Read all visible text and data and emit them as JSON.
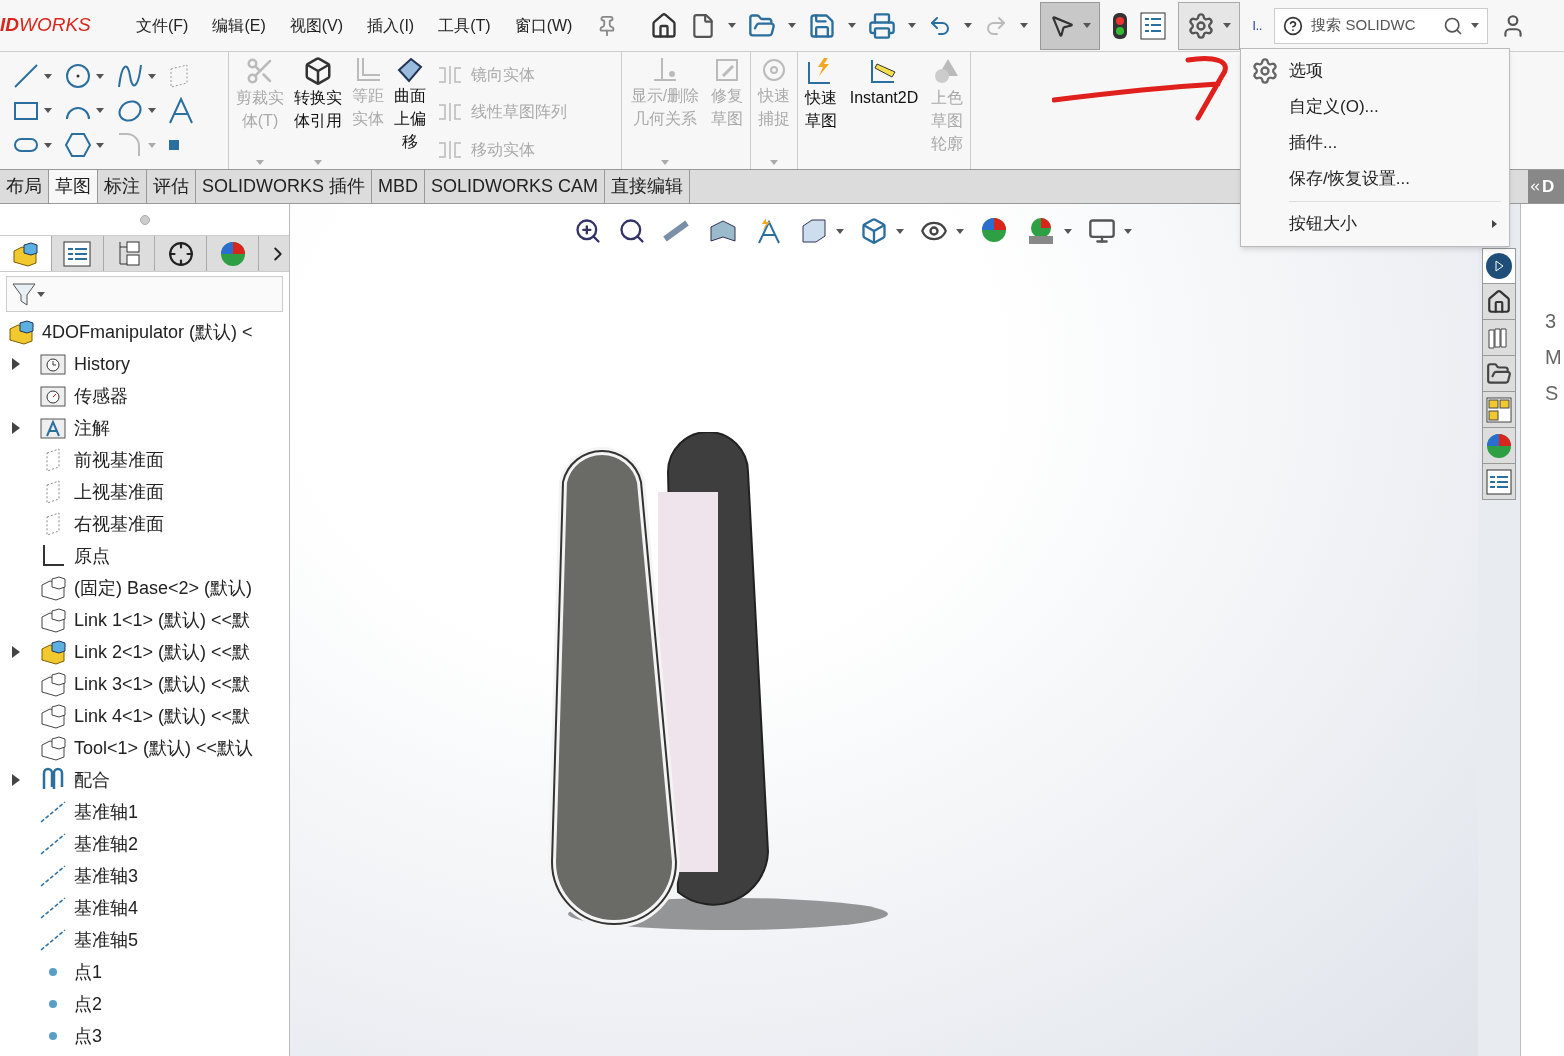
{
  "logo": "**ID**WORKS",
  "menu_bar": [
    "文件(F)",
    "编辑(E)",
    "视图(V)",
    "插入(I)",
    "工具(T)",
    "窗口(W)"
  ],
  "overflow_label": "I..",
  "search": {
    "placeholder": "搜索 SOLIDWC"
  },
  "command_groups": [
    {
      "kind": "sketch"
    },
    {
      "kind": "buttons",
      "items": [
        {
          "label": "剪裁实体(T)",
          "disabled": true,
          "dropdown": true
        },
        {
          "label": "转换实体引用",
          "disabled": false,
          "dropdown": true
        },
        {
          "label": "等距实体",
          "disabled": true,
          "dropdown": false
        },
        {
          "label": "曲面上偏移",
          "disabled": false,
          "dropdown": false
        }
      ],
      "small_items": [
        {
          "label": "镜向实体",
          "disabled": true
        },
        {
          "label": "线性草图阵列",
          "disabled": true
        },
        {
          "label": "移动实体",
          "disabled": true
        }
      ]
    },
    {
      "kind": "buttons",
      "items": [
        {
          "label": "显示/删除几何关系",
          "disabled": true,
          "dropdown": true
        },
        {
          "label": "修复草图",
          "disabled": true,
          "dropdown": false
        }
      ]
    },
    {
      "kind": "buttons",
      "items": [
        {
          "label": "快速捕捉",
          "disabled": true,
          "dropdown": true
        }
      ]
    },
    {
      "kind": "buttons",
      "items": [
        {
          "label": "快速草图",
          "disabled": false,
          "dropdown": false
        },
        {
          "label": "Instant2D",
          "disabled": false,
          "dropdown": false
        },
        {
          "label": "上色草图轮廓",
          "disabled": true,
          "dropdown": false
        }
      ]
    }
  ],
  "tabs": [
    {
      "label": "布局",
      "selected": false
    },
    {
      "label": "草图",
      "selected": true
    },
    {
      "label": "标注",
      "selected": false
    },
    {
      "label": "评估",
      "selected": false
    },
    {
      "label": "SOLIDWORKS 插件",
      "selected": false
    },
    {
      "label": "MBD",
      "selected": false
    },
    {
      "label": "SOLIDWORKS CAM",
      "selected": false
    },
    {
      "label": "直接编辑",
      "selected": false
    }
  ],
  "right_tab_label": "D",
  "options_menu": [
    {
      "label": "选项",
      "kind": "item"
    },
    {
      "label": "自定义(O)...",
      "kind": "item"
    },
    {
      "label": "插件...",
      "kind": "item"
    },
    {
      "label": "保存/恢复设置...",
      "kind": "item"
    },
    {
      "kind": "divider"
    },
    {
      "label": "按钮大小",
      "kind": "submenu"
    }
  ],
  "tree": [
    {
      "label": "4DOFmanipulator (默认) <",
      "kind": "part",
      "root": true
    },
    {
      "label": "History",
      "kind": "history",
      "expandable": true,
      "root": false
    },
    {
      "label": "传感器",
      "kind": "sensor",
      "expandable": false,
      "root": false
    },
    {
      "label": "注解",
      "kind": "annotation",
      "expandable": true,
      "root": false
    },
    {
      "label": "前视基准面",
      "kind": "plane",
      "expandable": false,
      "root": false
    },
    {
      "label": "上视基准面",
      "kind": "plane",
      "expandable": false,
      "root": false
    },
    {
      "label": "右视基准面",
      "kind": "plane",
      "expandable": false,
      "root": false
    },
    {
      "label": "原点",
      "kind": "origin",
      "expandable": false,
      "root": false
    },
    {
      "label": "(固定) Base<2> (默认)",
      "kind": "component",
      "expandable": false,
      "root": false
    },
    {
      "label": "Link 1<1> (默认) <<默",
      "kind": "component",
      "expandable": false,
      "root": false
    },
    {
      "label": "Link 2<1> (默认) <<默",
      "kind": "component-active",
      "expandable": true,
      "root": false
    },
    {
      "label": "Link 3<1> (默认) <<默",
      "kind": "component",
      "expandable": false,
      "root": false
    },
    {
      "label": "Link 4<1> (默认) <<默",
      "kind": "component",
      "expandable": false,
      "root": false
    },
    {
      "label": "Tool<1> (默认) <<默认",
      "kind": "component",
      "expandable": false,
      "root": false
    },
    {
      "label": "配合",
      "kind": "mates",
      "expandable": true,
      "root": false
    },
    {
      "label": "基准轴1",
      "kind": "axis",
      "expandable": false,
      "root": false
    },
    {
      "label": "基准轴2",
      "kind": "axis",
      "expandable": false,
      "root": false
    },
    {
      "label": "基准轴3",
      "kind": "axis",
      "expandable": false,
      "root": false
    },
    {
      "label": "基准轴4",
      "kind": "axis",
      "expandable": false,
      "root": false
    },
    {
      "label": "基准轴5",
      "kind": "axis",
      "expandable": false,
      "root": false
    },
    {
      "label": "点1",
      "kind": "point",
      "expandable": false,
      "root": false
    },
    {
      "label": "点2",
      "kind": "point",
      "expandable": false,
      "root": false
    },
    {
      "label": "点3",
      "kind": "point",
      "expandable": false,
      "root": false
    }
  ],
  "task_pane_tabs": [
    {
      "selected": true
    },
    {
      "selected": false
    },
    {
      "selected": false
    },
    {
      "selected": false
    },
    {
      "selected": false
    },
    {
      "selected": false
    },
    {
      "selected": false
    }
  ],
  "right_panel_texts": [
    "3",
    "M",
    "S"
  ]
}
